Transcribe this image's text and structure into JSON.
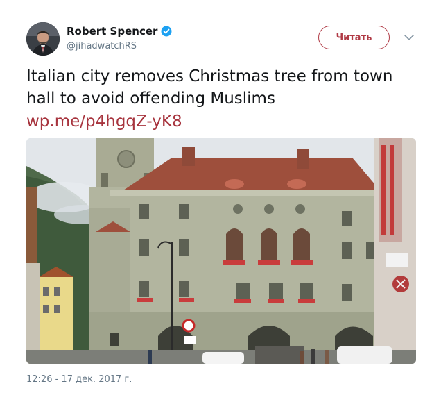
{
  "author": {
    "name": "Robert Spencer",
    "handle": "@jihadwatchRS",
    "verified": true,
    "avatar_icon": "user-avatar-photo"
  },
  "follow_button": {
    "label": "Читать"
  },
  "menu_icon": "chevron-down-icon",
  "tweet": {
    "text": "Italian city removes Christmas tree from town hall to avoid offending Muslims",
    "link": "wp.me/p4hgqZ-yK8"
  },
  "media": {
    "type": "photo",
    "subject": "town-hall-building-photo"
  },
  "timestamp": "12:26 - 17 дек. 2017 г.",
  "colors": {
    "accent": "#a7343e",
    "text": "#14171a",
    "secondary": "#657786",
    "verified": "#1da1f2"
  }
}
